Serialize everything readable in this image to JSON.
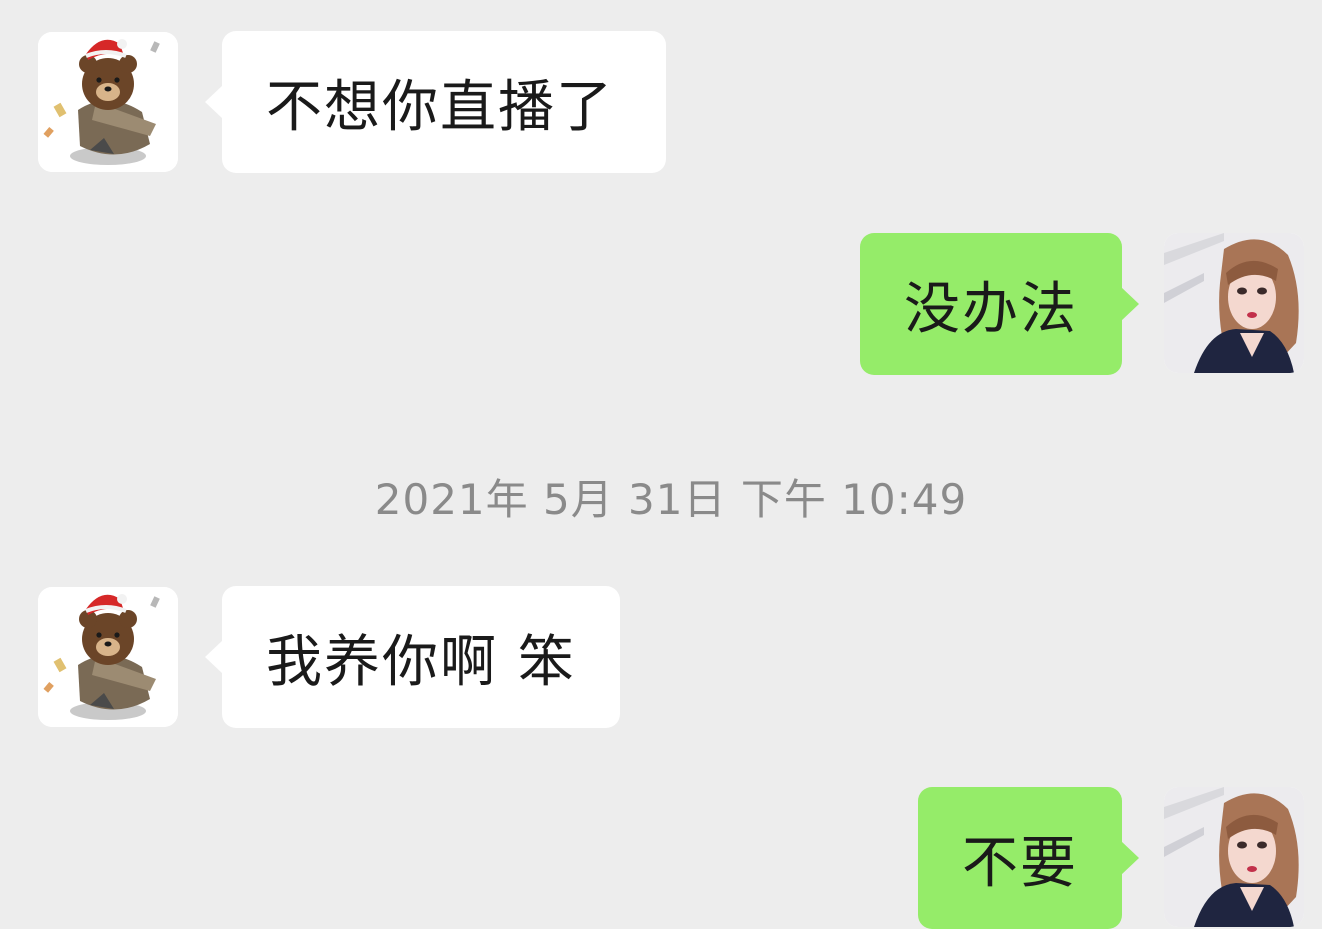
{
  "chat": {
    "messages": [
      {
        "side": "received",
        "sender_avatar": "bear-avatar",
        "text": "不想你直播了"
      },
      {
        "side": "sent",
        "sender_avatar": "girl-avatar",
        "text": "没办法"
      },
      {
        "side": "received",
        "sender_avatar": "bear-avatar",
        "text": "我养你啊 笨"
      },
      {
        "side": "sent",
        "sender_avatar": "girl-avatar",
        "text": "不要"
      }
    ],
    "timestamp": "2021年 5月 31日 下午 10:49"
  },
  "colors": {
    "background": "#ededed",
    "incoming_bubble": "#ffffff",
    "outgoing_bubble": "#95ec69",
    "timestamp_text": "#8a8a8a"
  }
}
